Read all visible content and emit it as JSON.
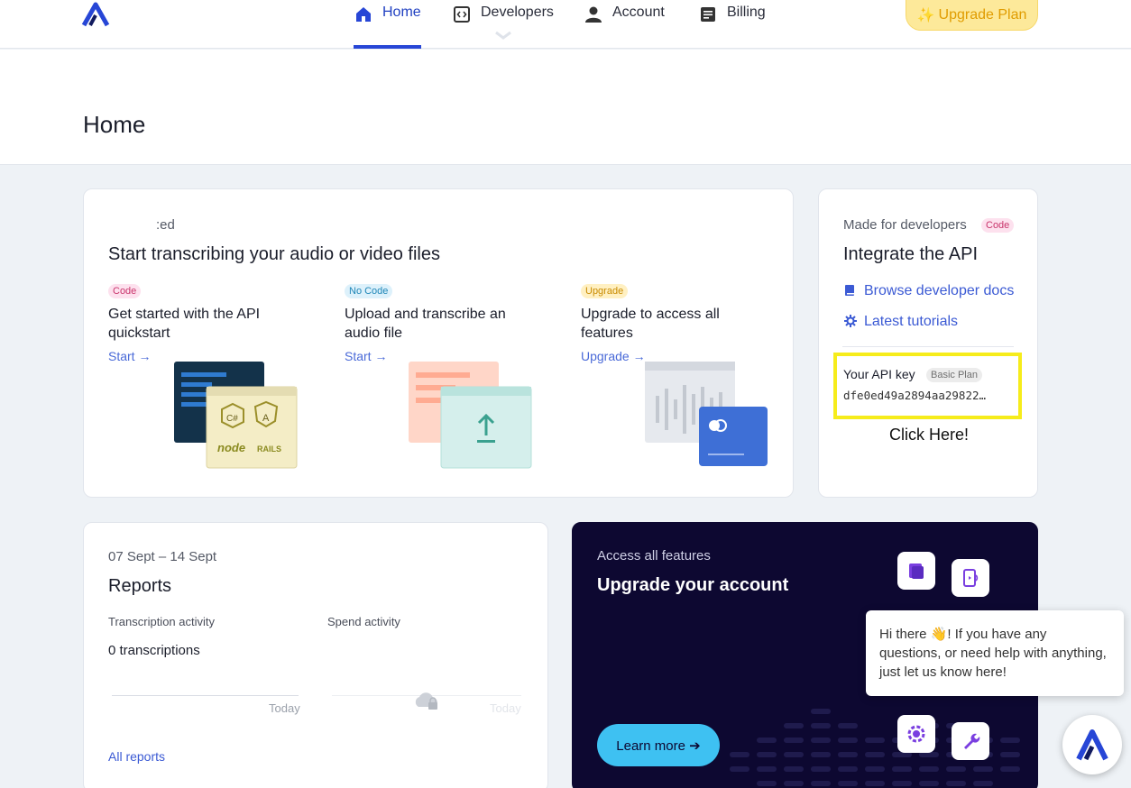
{
  "nav": {
    "home": "Home",
    "developers": "Developers",
    "account": "Account",
    "billing": "Billing",
    "upgrade": "Upgrade Plan"
  },
  "page": {
    "title": "Home"
  },
  "start_card": {
    "eyebrow": ":ed",
    "title": "Start transcribing your audio or video files",
    "columns": [
      {
        "badge": "Code",
        "title": "Get started with the API quickstart",
        "link": "Start →"
      },
      {
        "badge": "No Code",
        "title": "Upload and transcribe an audio file",
        "link": "Start →"
      },
      {
        "badge": "Upgrade",
        "title": "Upgrade to access all features",
        "link": "Upgrade →"
      }
    ]
  },
  "api_card": {
    "eyebrow": "Made for developers",
    "badge": "Code",
    "title": "Integrate the API",
    "links": [
      "Browse developer docs",
      "Latest tutorials"
    ],
    "key_label": "Your API key",
    "key_badge": "Basic Plan",
    "key_value": "dfe0ed49a2894aa29822…",
    "callout": "Click Here!"
  },
  "reports": {
    "date_range": "07 Sept – 14 Sept",
    "title": "Reports",
    "transcription_label": "Transcription activity",
    "transcription_value": "0 transcriptions",
    "spend_label": "Spend activity",
    "today": "Today",
    "all_reports": "All reports"
  },
  "upgrade_card": {
    "eyebrow": "Access all features",
    "title": "Upgrade your account",
    "button": "Learn more ➔"
  },
  "chat": {
    "message": "Hi there 👋! If you have any questions, or need help with anything, just let us know here!"
  },
  "colors": {
    "accent": "#2746d6",
    "upgrade_bg": "#fde99a",
    "dark_bg": "#0d0831",
    "cta": "#3ec1f2",
    "highlight": "#f6ec1b"
  }
}
